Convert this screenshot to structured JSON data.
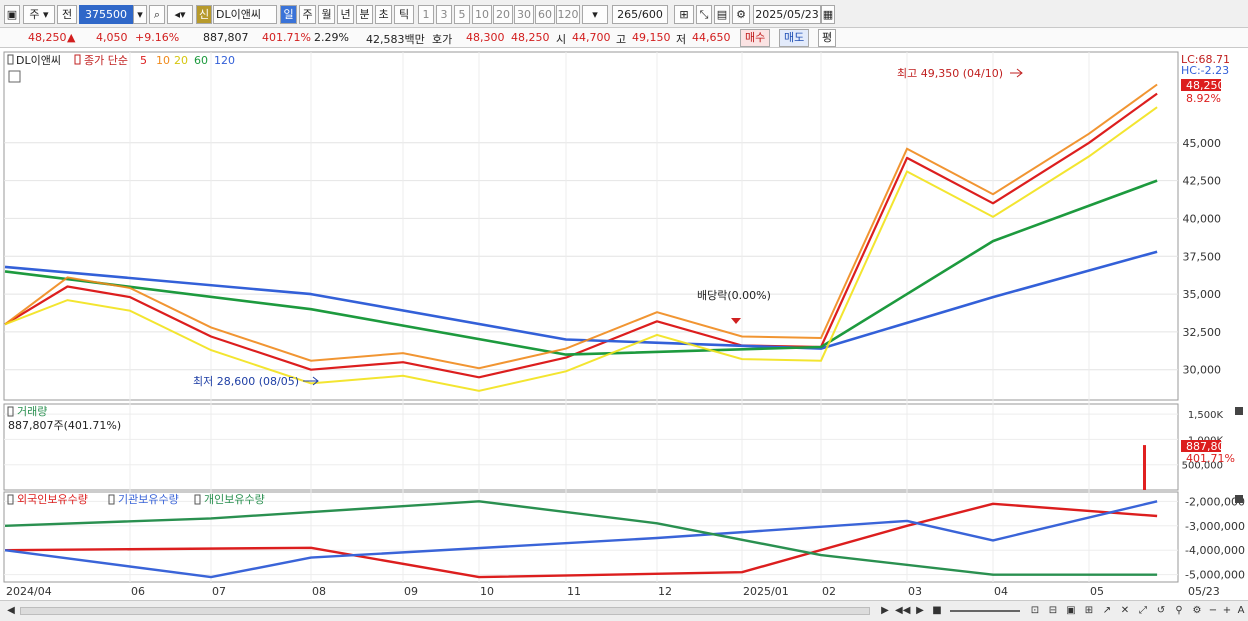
{
  "toolbar": {
    "market": "주",
    "scope": "전",
    "code": "375500",
    "badge": "신",
    "name": "DL이앤씨",
    "periods": [
      "일",
      "주",
      "월",
      "년",
      "분",
      "초",
      "틱"
    ],
    "intervals": [
      "1",
      "3",
      "5",
      "10",
      "20",
      "30",
      "60",
      "120"
    ],
    "count": "265",
    "count_total": "/600",
    "date": "2025/05/23"
  },
  "quote": {
    "price": "48,250",
    "change": "4,050",
    "change_pct": "+9.16%",
    "volume": "887,807",
    "vol_ratio": "401.71%",
    "turnover": "2.29%",
    "amount": "42,583백만",
    "ask_label": "호가",
    "ask": "48,300",
    "bid": "48,250",
    "open_label": "시",
    "open": "44,700",
    "high_label": "고",
    "high": "49,150",
    "low_label": "저",
    "low": "44,650",
    "buy_btn": "매수",
    "sell_btn": "매도",
    "avg_btn": "평"
  },
  "legend_price": {
    "name": "DL이앤씨",
    "title": "종가 단순",
    "ma": [
      "5",
      "10",
      "20",
      "60",
      "120"
    ]
  },
  "legend_volume": {
    "title": "거래량",
    "value": "887,807주(401.71%)"
  },
  "legend_holdings": {
    "items": [
      "외국인보유수량",
      "기관보유수량",
      "개인보유수량"
    ]
  },
  "info_right": {
    "lc": "LC:68.71",
    "hc": "HC:-2.23",
    "price_tag": "48,250",
    "pct_tag": "8.92%",
    "vol_tag": "887,807",
    "vol_pct": "401.71%"
  },
  "annotations": {
    "high": "최고 49,350 (04/10)",
    "low": "최저 28,600 (08/05)",
    "dividend": "배당락(0.00%)"
  },
  "colors": {
    "up": "#e02020",
    "down": "#1f58d6",
    "ma5": "#dc1e1e",
    "ma10": "#f08a1c",
    "ma20": "#f2e21a",
    "ma60": "#1d9a3e",
    "ma120": "#3360d8",
    "foreign": "#dc1e1e",
    "inst": "#3a64d8",
    "indiv": "#2a9050"
  },
  "chart_data": [
    {
      "type": "line",
      "title": "DL이앤씨 일봉 (종가, 이동평균 5/10/20/60/120)",
      "x_ticks": [
        "2024/04",
        "06",
        "07",
        "08",
        "09",
        "10",
        "11",
        "12",
        "2025/01",
        "02",
        "03",
        "04",
        "05",
        "05/23"
      ],
      "ylim": [
        28000,
        51000
      ],
      "y_ticks": [
        "30,000",
        "32,500",
        "35,000",
        "37,500",
        "40,000",
        "42,500",
        "45,000"
      ],
      "series": [
        {
          "name": "종가",
          "x": [
            "2024/04",
            "2024/05",
            "2024/06",
            "2024/07",
            "2024/08",
            "2024/09",
            "2024/10",
            "2024/11",
            "2024/12",
            "2025/01",
            "2025/02",
            "2025/03",
            "2025/04",
            "2025/05",
            "2025/05/23"
          ],
          "values": [
            33000,
            35500,
            34800,
            32200,
            30000,
            30500,
            29500,
            30800,
            33200,
            31600,
            31500,
            44000,
            41000,
            45000,
            48250
          ]
        },
        {
          "name": "120",
          "x": [
            "2024/04",
            "2024/08",
            "2024/11",
            "2025/02",
            "2025/04",
            "2025/05/23"
          ],
          "values": [
            36800,
            35000,
            32000,
            31400,
            34800,
            37800
          ]
        },
        {
          "name": "60",
          "x": [
            "2024/04",
            "2024/08",
            "2024/11",
            "2025/02",
            "2025/04",
            "2025/05/23"
          ],
          "values": [
            36500,
            34000,
            31000,
            31500,
            38500,
            42500
          ]
        }
      ],
      "annotations": [
        {
          "text": "최고 49,350 (04/10)",
          "x": "2025/04/10",
          "y": 49350
        },
        {
          "text": "최저 28,600 (08/05)",
          "x": "2024/08/05",
          "y": 28600
        },
        {
          "text": "배당락(0.00%)",
          "x": "2024/12/27"
        }
      ]
    },
    {
      "type": "bar",
      "title": "거래량",
      "y_ticks": [
        "500,000",
        "1,000,000",
        "1,500,000"
      ],
      "last_value": 887807
    },
    {
      "type": "line",
      "series": [
        {
          "name": "외국인보유수량",
          "x": [
            "2024/04",
            "2024/08",
            "2024/10",
            "2025/01",
            "2025/03",
            "2025/04",
            "2025/05/23"
          ],
          "values": [
            -4000000,
            -3900000,
            -5100000,
            -4900000,
            -3000000,
            -2100000,
            -2600000
          ]
        },
        {
          "name": "기관보유수량",
          "x": [
            "2024/04",
            "2024/07",
            "2024/08",
            "2024/12",
            "2025/03",
            "2025/04",
            "2025/05/23"
          ],
          "values": [
            -4000000,
            -5100000,
            -4300000,
            -3500000,
            -2800000,
            -3600000,
            -2000000
          ]
        },
        {
          "name": "개인보유수량",
          "x": [
            "2024/04",
            "2024/07",
            "2024/10",
            "2024/12",
            "2025/02",
            "2025/04",
            "2025/05/23"
          ],
          "values": [
            -3000000,
            -2700000,
            -2000000,
            -2900000,
            -4200000,
            -5000000,
            -5000000
          ]
        }
      ],
      "y_ticks": [
        "-2,000,000",
        "-3,000,000",
        "-4,000,000",
        "-5,000,000"
      ]
    }
  ]
}
